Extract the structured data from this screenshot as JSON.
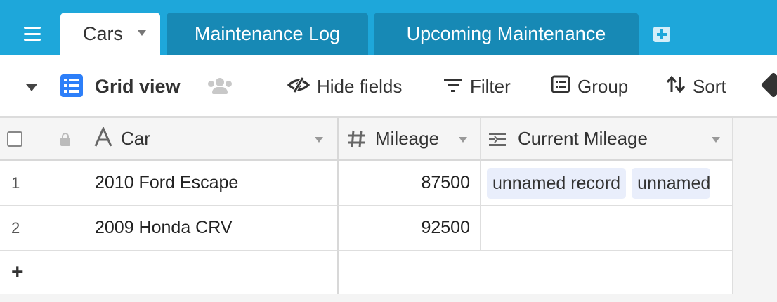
{
  "tabs": [
    {
      "label": "Cars",
      "active": true
    },
    {
      "label": "Maintenance Log",
      "active": false
    },
    {
      "label": "Upcoming Maintenance",
      "active": false
    }
  ],
  "toolbar": {
    "view_name": "Grid view",
    "hide_fields": "Hide fields",
    "filter": "Filter",
    "group": "Group",
    "sort": "Sort"
  },
  "columns": {
    "car": "Car",
    "mileage": "Mileage",
    "current_mileage": "Current Mileage"
  },
  "rows": [
    {
      "num": "1",
      "car": "2010 Ford Escape",
      "mileage": "87500",
      "links": [
        "unnamed record",
        "unnamed"
      ]
    },
    {
      "num": "2",
      "car": "2009 Honda CRV",
      "mileage": "92500",
      "links": []
    }
  ],
  "add_row": "+",
  "colors": {
    "tabbar": "#1ea7da",
    "inactive_tab": "#1789b5",
    "accent_blue": "#2d7ff9",
    "link_pill": "#e9eefb"
  }
}
